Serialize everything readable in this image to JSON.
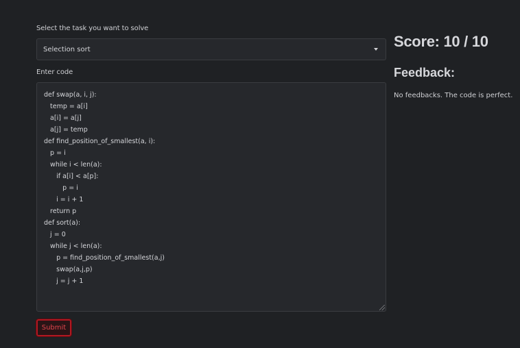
{
  "form": {
    "task_label": "Select the task you want to solve",
    "task_selected": "Selection sort",
    "code_label": "Enter code",
    "code_lines": [
      "def swap(a, i, j):",
      "   temp = a[i]",
      "   a[i] = a[j]",
      "   a[j] = temp",
      "def find_position_of_smallest(a, i):",
      "   p = i",
      "   while i < len(a):",
      "      if a[i] < a[p]:",
      "         p = i",
      "      i = i + 1",
      "   return p",
      "def sort(a):",
      "   j = 0",
      "   while j < len(a):",
      "      p = find_position_of_smallest(a,j)",
      "      swap(a,j,p)",
      "      j = j + 1"
    ],
    "submit_label": "Submit"
  },
  "result": {
    "score_text": "Score: 10 / 10",
    "feedback_title": "Feedback:",
    "feedback_text": "No feedbacks. The code is perfect."
  },
  "colors": {
    "background": "#1f2124",
    "submit_border": "#b01922",
    "submit_text": "#e0444c"
  },
  "icons": {
    "select_caret": "chevron-down-icon",
    "resize_grip": "resize-handle-icon"
  }
}
